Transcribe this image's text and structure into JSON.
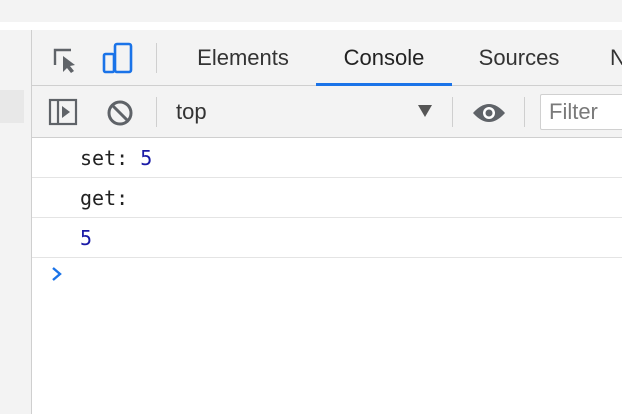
{
  "devtools": {
    "tabs": [
      {
        "label": "Elements"
      },
      {
        "label": "Console"
      },
      {
        "label": "Sources"
      },
      {
        "label": "N"
      }
    ],
    "active_tab": "Console",
    "accent_color": "#1a73e8"
  },
  "toolbar": {
    "context": "top",
    "filter_placeholder": "Filter"
  },
  "console": {
    "messages": [
      {
        "prefix": "set: ",
        "value": "5"
      },
      {
        "prefix": "get:",
        "value": ""
      },
      {
        "prefix": "",
        "value": "5"
      }
    ],
    "number_color": "#1a1aa6"
  },
  "icons": {
    "inspect": "inspect-element-icon",
    "device": "device-toolbar-icon",
    "sidebar": "show-sidebar-icon",
    "clear": "clear-console-icon",
    "eye": "live-expression-icon",
    "prompt": "console-prompt-icon"
  }
}
